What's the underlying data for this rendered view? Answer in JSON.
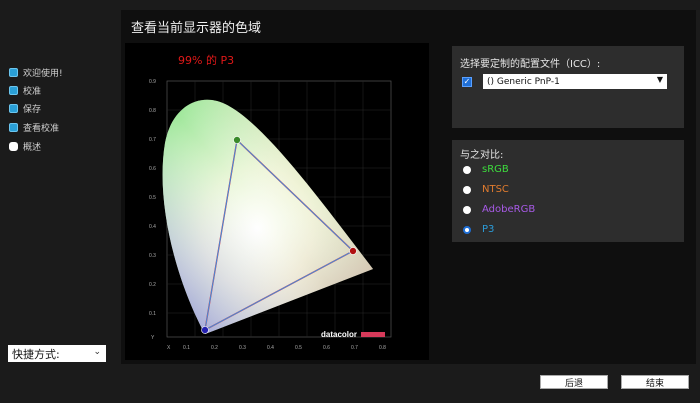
{
  "window": {
    "title": "查看当前显示器的色域"
  },
  "sidebar": {
    "steps": [
      {
        "label": "欢迎使用!"
      },
      {
        "label": "校准"
      },
      {
        "label": "保存"
      },
      {
        "label": "查看校准"
      },
      {
        "label": "概述"
      }
    ],
    "shortcut_label": "快捷方式:"
  },
  "chart": {
    "caption": "99% 的 P3",
    "brand": "datacolor",
    "x_ticks": [
      "X",
      "0.1",
      "0.2",
      "0.3",
      "0.4",
      "0.5",
      "0.6",
      "0.7",
      "0.8"
    ],
    "y_ticks": [
      "0.9",
      "0.8",
      "0.7",
      "0.6",
      "0.5",
      "0.4",
      "0.3",
      "0.2",
      "0.1",
      "Y"
    ]
  },
  "icc": {
    "title": "选择要定制的配置文件（ICC）:",
    "checked": true,
    "selected": "() Generic PnP-1"
  },
  "compare": {
    "title": "与之对比:",
    "options": [
      {
        "label": "sRGB",
        "color": "#3ddc3d"
      },
      {
        "label": "NTSC",
        "color": "#e07b2e"
      },
      {
        "label": "AdobeRGB",
        "color": "#a75ae6"
      },
      {
        "label": "P3",
        "color": "#2b9bd8"
      }
    ],
    "selected": "P3"
  },
  "footer": {
    "back_label": "后退",
    "finish_label": "结束"
  }
}
